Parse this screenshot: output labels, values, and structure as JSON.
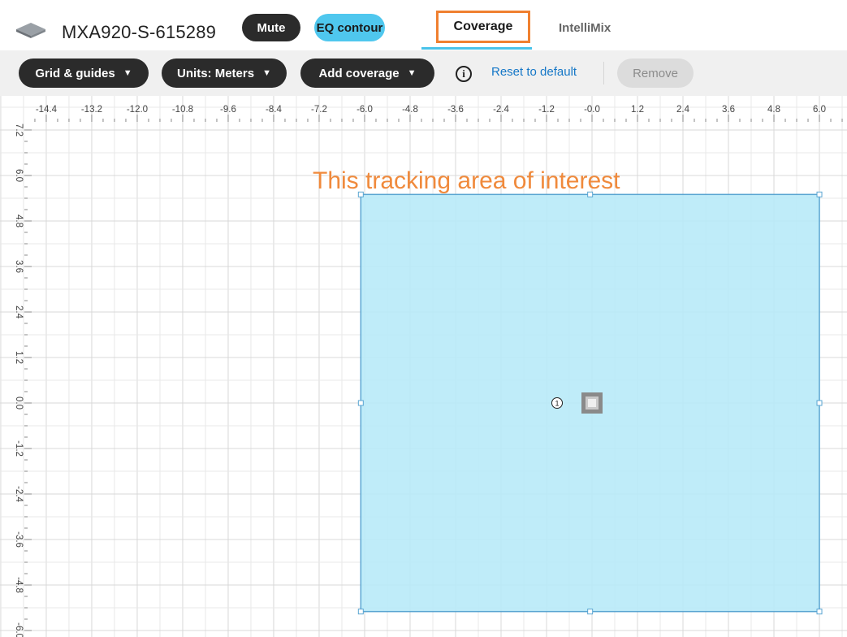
{
  "header": {
    "device_name": "MXA920-S-615289",
    "mute_label": "Mute",
    "eq_label": "EQ contour",
    "tabs": [
      {
        "label": "Coverage",
        "active": true
      },
      {
        "label": "IntelliMix",
        "active": false
      }
    ]
  },
  "toolbar": {
    "grid_label": "Grid & guides",
    "units_label": "Units: Meters",
    "add_coverage_label": "Add coverage",
    "reset_label": "Reset to default",
    "remove_label": "Remove",
    "info_icon": "info-icon"
  },
  "canvas": {
    "units": "m",
    "x_ticks": [
      "-14.4",
      "-13.2",
      "-12.0",
      "-10.8",
      "-9.6",
      "-8.4",
      "-7.2",
      "-6.0",
      "-4.8",
      "-3.6",
      "-2.4",
      "-1.2",
      "-0.0",
      "1.2",
      "2.4",
      "3.6",
      "4.8",
      "6.0"
    ],
    "y_ticks": [
      "7.2",
      "6.0",
      "4.8",
      "3.6",
      "2.4",
      "1.2",
      "0.0",
      "-1.2",
      "-2.4",
      "-3.6",
      "-4.8",
      "-6.0"
    ],
    "coverage_area": {
      "id": "1",
      "x_range": [
        -6.1,
        6.0
      ],
      "y_range": [
        -5.5,
        5.5
      ],
      "fill": "#b6e9f8",
      "stroke": "#5aa5d2"
    },
    "microphone": {
      "x": 0.0,
      "y": 0.0,
      "icon": "microphone-icon"
    },
    "annotation": "This tracking area of interest",
    "annotation_color": "#f08a3c"
  },
  "colors": {
    "accent_blue": "#49c3ea",
    "highlight_orange": "#f08030",
    "dark_pill": "#2b2b2b",
    "link_blue": "#1577c7"
  }
}
